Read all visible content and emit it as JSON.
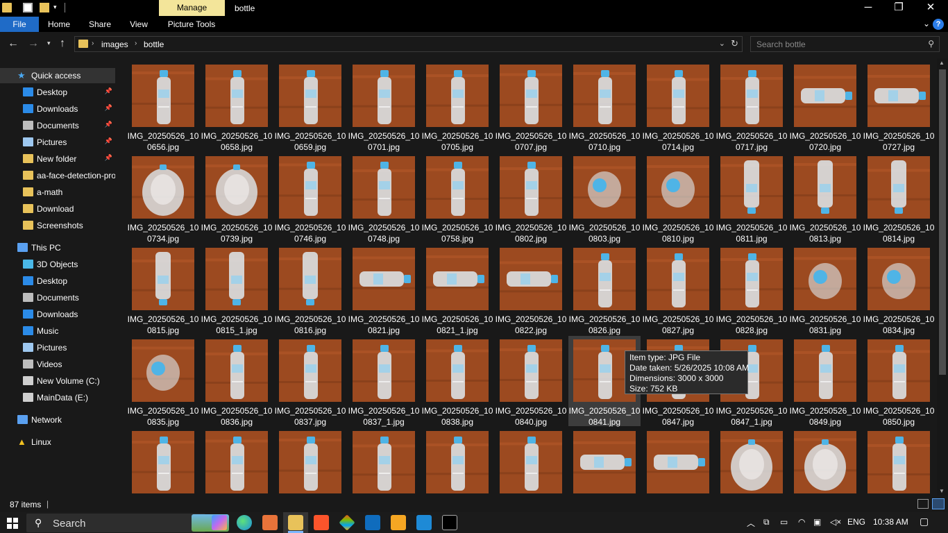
{
  "titlebar": {
    "manage_label": "Manage",
    "title": "bottle",
    "minimize": "─",
    "maximize": "❐",
    "close": "✕"
  },
  "ribbon": {
    "tabs": [
      "File",
      "Home",
      "Share",
      "View",
      "Picture Tools"
    ],
    "expand_icon": "chevron-down-icon",
    "help": "?"
  },
  "address": {
    "crumbs": [
      "images",
      "bottle"
    ],
    "search_placeholder": "Search bottle"
  },
  "nav": {
    "quick_access": "Quick access",
    "quick_items": [
      "Desktop",
      "Downloads",
      "Documents",
      "Pictures",
      "New folder",
      "aa-face-detection-pro",
      "a-math",
      "Download",
      "Screenshots"
    ],
    "this_pc": "This PC",
    "pc_items": [
      "3D Objects",
      "Desktop",
      "Documents",
      "Downloads",
      "Music",
      "Pictures",
      "Videos",
      "New Volume (C:)",
      "MainData (E:)"
    ],
    "network": "Network",
    "linux": "Linux"
  },
  "files": [
    {
      "name": "IMG_20250526_100656.jpg",
      "kind": "up"
    },
    {
      "name": "IMG_20250526_100658.jpg",
      "kind": "up"
    },
    {
      "name": "IMG_20250526_100659.jpg",
      "kind": "up"
    },
    {
      "name": "IMG_20250526_100701.jpg",
      "kind": "up"
    },
    {
      "name": "IMG_20250526_100705.jpg",
      "kind": "up"
    },
    {
      "name": "IMG_20250526_100707.jpg",
      "kind": "up"
    },
    {
      "name": "IMG_20250526_100710.jpg",
      "kind": "up"
    },
    {
      "name": "IMG_20250526_100714.jpg",
      "kind": "up"
    },
    {
      "name": "IMG_20250526_100717.jpg",
      "kind": "up"
    },
    {
      "name": "IMG_20250526_100720.jpg",
      "kind": "side"
    },
    {
      "name": "IMG_20250526_100727.jpg",
      "kind": "side"
    },
    {
      "name": "IMG_20250526_100734.jpg",
      "kind": "base"
    },
    {
      "name": "IMG_20250526_100739.jpg",
      "kind": "base"
    },
    {
      "name": "IMG_20250526_100746.jpg",
      "kind": "up"
    },
    {
      "name": "IMG_20250526_100748.jpg",
      "kind": "up"
    },
    {
      "name": "IMG_20250526_100758.jpg",
      "kind": "up"
    },
    {
      "name": "IMG_20250526_100802.jpg",
      "kind": "up"
    },
    {
      "name": "IMG_20250526_100803.jpg",
      "kind": "cap"
    },
    {
      "name": "IMG_20250526_100810.jpg",
      "kind": "cap"
    },
    {
      "name": "IMG_20250526_100811.jpg",
      "kind": "down"
    },
    {
      "name": "IMG_20250526_100813.jpg",
      "kind": "down"
    },
    {
      "name": "IMG_20250526_100814.jpg",
      "kind": "down"
    },
    {
      "name": "IMG_20250526_100815.jpg",
      "kind": "down"
    },
    {
      "name": "IMG_20250526_100815_1.jpg",
      "kind": "down"
    },
    {
      "name": "IMG_20250526_100816.jpg",
      "kind": "down"
    },
    {
      "name": "IMG_20250526_100821.jpg",
      "kind": "side"
    },
    {
      "name": "IMG_20250526_100821_1.jpg",
      "kind": "side"
    },
    {
      "name": "IMG_20250526_100822.jpg",
      "kind": "side"
    },
    {
      "name": "IMG_20250526_100826.jpg",
      "kind": "up"
    },
    {
      "name": "IMG_20250526_100827.jpg",
      "kind": "up"
    },
    {
      "name": "IMG_20250526_100828.jpg",
      "kind": "up"
    },
    {
      "name": "IMG_20250526_100831.jpg",
      "kind": "cap"
    },
    {
      "name": "IMG_20250526_100834.jpg",
      "kind": "cap"
    },
    {
      "name": "IMG_20250526_100835.jpg",
      "kind": "cap"
    },
    {
      "name": "IMG_20250526_100836.jpg",
      "kind": "up"
    },
    {
      "name": "IMG_20250526_100837.jpg",
      "kind": "up"
    },
    {
      "name": "IMG_20250526_100837_1.jpg",
      "kind": "up"
    },
    {
      "name": "IMG_20250526_100838.jpg",
      "kind": "up"
    },
    {
      "name": "IMG_20250526_100840.jpg",
      "kind": "up"
    },
    {
      "name": "IMG_20250526_100841.jpg",
      "kind": "up"
    },
    {
      "name": "IMG_20250526_100847.jpg",
      "kind": "up"
    },
    {
      "name": "IMG_20250526_100847_1.jpg",
      "kind": "up"
    },
    {
      "name": "IMG_20250526_100849.jpg",
      "kind": "up"
    },
    {
      "name": "IMG_20250526_100850.jpg",
      "kind": "up"
    },
    {
      "name": "",
      "kind": "up"
    },
    {
      "name": "",
      "kind": "up"
    },
    {
      "name": "",
      "kind": "up"
    },
    {
      "name": "",
      "kind": "up"
    },
    {
      "name": "",
      "kind": "up"
    },
    {
      "name": "",
      "kind": "up"
    },
    {
      "name": "",
      "kind": "side"
    },
    {
      "name": "",
      "kind": "side"
    },
    {
      "name": "",
      "kind": "base"
    },
    {
      "name": "",
      "kind": "base"
    },
    {
      "name": "",
      "kind": "up"
    }
  ],
  "hovered_file": "IMG_20250526_100841.jpg",
  "tooltip": {
    "type": "Item type: JPG File",
    "date": "Date taken: 5/26/2025 10:08 AM",
    "dimensions": "Dimensions: 3000 x 3000",
    "size": "Size: 752 KB"
  },
  "status": {
    "item_count": "87 items",
    "separator": "|"
  },
  "taskbar": {
    "search_label": "Search",
    "language": "ENG",
    "time": "10:38 AM"
  },
  "colors": {
    "accent": "#1f6bc7",
    "manage": "#f3e59a",
    "folder": "#e8c25a",
    "table": "#9c4a20",
    "cap": "#4fb4e6"
  }
}
